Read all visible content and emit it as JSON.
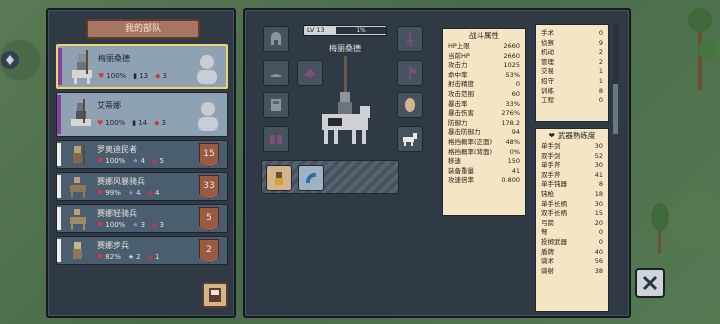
{
  "left_panel": {
    "title": "我的部队",
    "units": [
      {
        "name": "梅丽桑德",
        "hp": "100%",
        "rank": "13",
        "troops": "3",
        "selected": true,
        "size": "big"
      },
      {
        "name": "艾蒂娜",
        "hp": "100%",
        "rank": "14",
        "troops": "3",
        "selected": false,
        "size": "big"
      },
      {
        "name": "罗奥迪民者",
        "hp": "100%",
        "rank": "4",
        "troops": "5",
        "badge": "15",
        "size": "small"
      },
      {
        "name": "赛娜风暴骑兵",
        "hp": "99%",
        "rank": "4",
        "troops": "4",
        "badge": "33",
        "size": "small"
      },
      {
        "name": "赛娜轻骑兵",
        "hp": "100%",
        "rank": "3",
        "troops": "3",
        "badge": "5",
        "size": "small"
      },
      {
        "name": "赛娜步兵",
        "hp": "82%",
        "rank": "2",
        "troops": "1",
        "badge": "2",
        "size": "small"
      }
    ]
  },
  "hero": {
    "level_label": "LV 13",
    "xp_label": "1%",
    "name": "梅丽桑德"
  },
  "combat_stats": {
    "title": "战斗属性",
    "rows": [
      {
        "k": "HP上限",
        "v": "2660"
      },
      {
        "k": "当前HP",
        "v": "2660"
      },
      {
        "k": "攻击力",
        "v": "1025"
      },
      {
        "k": "命中率",
        "v": "53%"
      },
      {
        "k": "射击精度",
        "v": "0"
      },
      {
        "k": "攻击范围",
        "v": "60"
      },
      {
        "k": "暴击率",
        "v": "33%"
      },
      {
        "k": "暴击伤害",
        "v": "276%"
      },
      {
        "k": "防御力",
        "v": "178.2"
      },
      {
        "k": "暴击防御力",
        "v": "94"
      },
      {
        "k": "格挡概率(正面)",
        "v": "48%"
      },
      {
        "k": "格挡概率(背面)",
        "v": "0%"
      },
      {
        "k": "移速",
        "v": "150"
      },
      {
        "k": "装备重量",
        "v": "41"
      },
      {
        "k": "攻速倍率",
        "v": "0.800"
      }
    ]
  },
  "skills": {
    "rows": [
      {
        "k": "手术",
        "v": "0"
      },
      {
        "k": "侦察",
        "v": "9"
      },
      {
        "k": "机动",
        "v": "2"
      },
      {
        "k": "管理",
        "v": "2"
      },
      {
        "k": "交易",
        "v": "1"
      },
      {
        "k": "招守",
        "v": "1"
      },
      {
        "k": "训练",
        "v": "8"
      },
      {
        "k": "工程",
        "v": "0"
      }
    ]
  },
  "weapons": {
    "title": "武器熟练度",
    "rows": [
      {
        "k": "单手剑",
        "v": "30"
      },
      {
        "k": "双手剑",
        "v": "52"
      },
      {
        "k": "单手斧",
        "v": "30"
      },
      {
        "k": "双手斧",
        "v": "41"
      },
      {
        "k": "单手钝器",
        "v": "8"
      },
      {
        "k": "钝枪",
        "v": "18"
      },
      {
        "k": "单手长柄",
        "v": "30"
      },
      {
        "k": "双手长柄",
        "v": "15"
      },
      {
        "k": "弓箭",
        "v": "20"
      },
      {
        "k": "弩",
        "v": "0"
      },
      {
        "k": "投掷武器",
        "v": "0"
      },
      {
        "k": "盾牌",
        "v": "40"
      },
      {
        "k": "骑术",
        "v": "56"
      },
      {
        "k": "骑射",
        "v": "38"
      }
    ]
  }
}
